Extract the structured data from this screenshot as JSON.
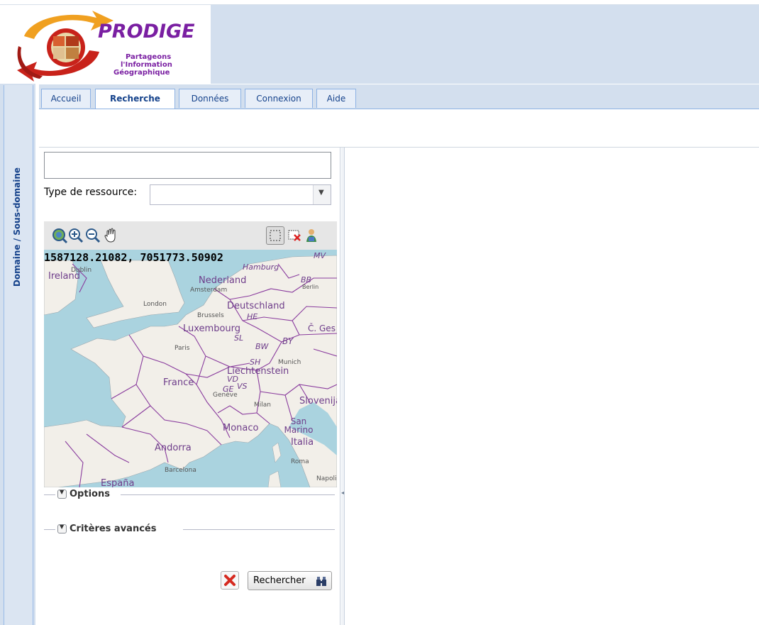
{
  "app": {
    "logo_text": "PRODIGE",
    "logo_tagline": [
      "Partageons",
      "l'Information",
      "Géographique"
    ]
  },
  "sidebar": {
    "title": "Domaine / Sous-domaine"
  },
  "tabs": [
    {
      "label": "Accueil",
      "active": false
    },
    {
      "label": "Recherche",
      "active": true
    },
    {
      "label": "Données",
      "active": false
    },
    {
      "label": "Connexion",
      "active": false
    },
    {
      "label": "Aide",
      "active": false
    }
  ],
  "search": {
    "query_value": "",
    "type_label": "Type de ressource:",
    "type_value": ""
  },
  "map": {
    "coordinates": "1587128.21082, 7051773.50902",
    "labels": {
      "ireland": "Ireland",
      "dublin": "Dublin",
      "london": "London",
      "nederland": "Nederland",
      "amsterdam": "Amsterdam",
      "hamburg": "Hamburg",
      "mv": "MV",
      "bb": "BB",
      "berlin": "Berlin",
      "deutschland": "Deutschland",
      "brussels": "Brussels",
      "he": "HE",
      "luxembourg": "Luxembourg",
      "sl": "SL",
      "by": "BY",
      "bw": "BW",
      "paris": "Paris",
      "france": "France",
      "munich": "Munich",
      "liechtenstein": "Liechtenstein",
      "sh": "SH",
      "vd": "VD",
      "ge": "GE",
      "vs": "VS",
      "geneve": "Genève",
      "slovenija": "Slovenija",
      "milan": "Milan",
      "monaco": "Monaco",
      "san_marino": "San Marino",
      "italia": "Italia",
      "andorra": "Andorra",
      "barcelona": "Barcelona",
      "roma": "Roma",
      "espana": "España",
      "napoli": "Napoli",
      "cesko": "Č. Ges"
    },
    "tools": [
      "zoom-extent-icon",
      "zoom-in-icon",
      "zoom-out-icon",
      "pan-hand-icon",
      "box-select-icon",
      "clear-selection-icon",
      "layers-icon"
    ]
  },
  "fieldsets": {
    "options": "Options",
    "advanced": "Critères avancés"
  },
  "buttons": {
    "search_label": "Rechercher"
  },
  "colors": {
    "header_bg": "#d3dfee",
    "tab_text": "#15428b",
    "logo_red": "#c8221a",
    "logo_orange": "#f0a020",
    "logo_purple": "#7a1fa2",
    "map_sea": "#aad3df",
    "map_land": "#f2efe9",
    "map_border": "#8a3c9e"
  }
}
